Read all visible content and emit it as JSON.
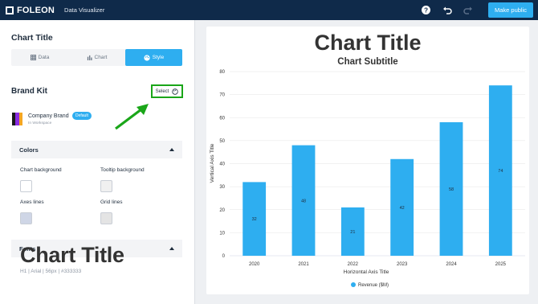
{
  "topbar": {
    "logo_text": "FOLEON",
    "app_name": "Data Visualizer",
    "make_public_label": "Make public",
    "icons": [
      "help-icon",
      "undo-icon",
      "redo-icon"
    ]
  },
  "left_panel": {
    "title": "Chart Title",
    "tabs": [
      {
        "label": "Data",
        "icon": "table-icon",
        "active": false
      },
      {
        "label": "Chart",
        "icon": "bar-chart-icon",
        "active": false
      },
      {
        "label": "Style",
        "icon": "palette-icon",
        "active": true
      }
    ],
    "brand_kit": {
      "title": "Brand Kit",
      "select_label": "Select",
      "brand_name": "Company Brand",
      "badge": "Default",
      "workspace": "In Workspace",
      "swatch_colors": [
        "#1a1a1a",
        "#8a2be2",
        "#f5a623"
      ]
    },
    "colors": {
      "title": "Colors",
      "items": [
        {
          "label": "Chart background",
          "value": "#ffffff"
        },
        {
          "label": "Tooltip background",
          "value": "#f0f0f0"
        },
        {
          "label": "Axes lines",
          "value": "#cfd6e6"
        },
        {
          "label": "Grid lines",
          "value": "#e4e4e4"
        }
      ]
    },
    "fonts": {
      "title": "Fonts",
      "sample": "Chart Title",
      "meta": "H1 | Arial | 56px | #333333"
    }
  },
  "chart_data": {
    "type": "bar",
    "title": "Chart Title",
    "subtitle": "Chart Subtitle",
    "xlabel": "Horizontal Axis Title",
    "ylabel": "Vertical Axis Title",
    "categories": [
      "2020",
      "2021",
      "2022",
      "2023",
      "2024",
      "2025"
    ],
    "series": [
      {
        "name": "Revenue ($M)",
        "values": [
          32,
          48,
          21,
          42,
          58,
          74
        ],
        "color": "#2eaef0"
      }
    ],
    "ylim": [
      0,
      80
    ],
    "yticks": [
      0,
      10,
      20,
      30,
      40,
      50,
      60,
      70,
      80
    ],
    "grid": true,
    "legend": "bottom-center"
  }
}
